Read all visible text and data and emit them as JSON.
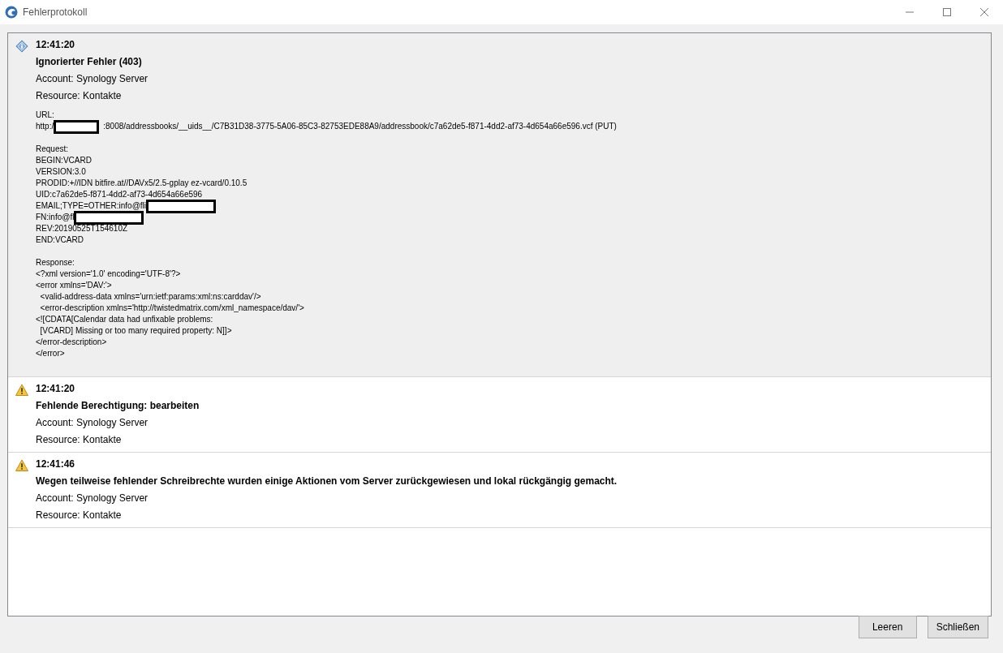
{
  "window": {
    "title": "Fehlerprotokoll"
  },
  "entries": [
    {
      "kind": "info",
      "selected": true,
      "time": "12:41:20",
      "title": "Ignorierter Fehler (403)",
      "account": "Account: Synology Server",
      "resource": "Resource: Kontakte",
      "details": [
        {
          "heading": "URL:",
          "lines": [
            {
              "text": "http:/",
              "redaction": true,
              "text_after": ":8008/addressbooks/__uids__/C7B31D38-3775-5A06-85C3-82753EDE88A9/addressbook/c7a62de5-f871-4dd2-af73-4d654a66e596.vcf (PUT)"
            }
          ]
        },
        {
          "heading": "Request:",
          "lines": [
            {
              "text": "BEGIN:VCARD",
              "redaction": false
            },
            {
              "text": "VERSION:3.0",
              "redaction": false
            },
            {
              "text": "PRODID:+//IDN bitfire.at//DAVx5/2.5-gplay ez-vcard/0.10.5",
              "redaction": false
            },
            {
              "text": "UID:c7a62de5-f871-4dd2-af73-4d654a66e596",
              "redaction": false
            },
            {
              "text": "EMAIL;TYPE=OTHER:info@fli",
              "redaction": true
            },
            {
              "text": "FN:info@fl",
              "redaction": true
            },
            {
              "text": "REV:20190525T154610Z",
              "redaction": false
            },
            {
              "text": "END:VCARD",
              "redaction": false
            }
          ]
        },
        {
          "heading": "Response:",
          "lines": [
            {
              "text": "<?xml version='1.0' encoding='UTF-8'?>",
              "redaction": false
            },
            {
              "text": "<error xmlns='DAV:'>",
              "redaction": false
            },
            {
              "text": "  <valid-address-data xmlns='urn:ietf:params:xml:ns:carddav'/>",
              "redaction": false
            },
            {
              "text": "  <error-description xmlns='http://twistedmatrix.com/xml_namespace/dav/'>",
              "redaction": false
            },
            {
              "text": "<![CDATA[Calendar data had unfixable problems:",
              "redaction": false
            },
            {
              "text": "  [VCARD] Missing or too many required property: N]]>",
              "redaction": false
            },
            {
              "text": "</error-description>",
              "redaction": false
            },
            {
              "text": "</error>",
              "redaction": false
            }
          ]
        }
      ]
    },
    {
      "kind": "warning",
      "selected": false,
      "time": "12:41:20",
      "title": "Fehlende Berechtigung: bearbeiten",
      "account": "Account: Synology Server",
      "resource": "Resource: Kontakte"
    },
    {
      "kind": "warning",
      "selected": false,
      "time": "12:41:46",
      "title": "Wegen teilweise fehlender Schreibrechte wurden einige Aktionen vom Server zurückgewiesen und lokal rückgängig gemacht.",
      "account": "Account: Synology Server",
      "resource": "Resource: Kontakte"
    }
  ],
  "buttons": [
    {
      "label": "Leeren"
    },
    {
      "label": "Schließen"
    }
  ]
}
